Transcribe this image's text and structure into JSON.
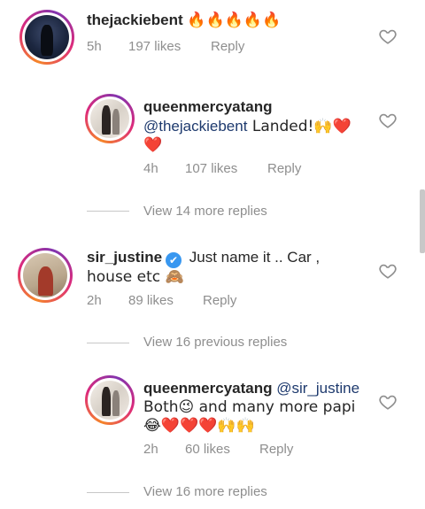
{
  "comments": [
    {
      "username": "thejackiebent",
      "text": "🔥🔥🔥🔥🔥",
      "time": "5h",
      "likes": "197 likes",
      "reply": "Reply"
    },
    {
      "username": "queenmercyatang",
      "mention": "@thejackiebent",
      "text": " Landed!🙌❤️",
      "text_line2": "❤️",
      "time": "4h",
      "likes": "107 likes",
      "reply": "Reply",
      "view_more": "View 14 more replies"
    },
    {
      "username": "sir_justine",
      "verified_icon": "✔",
      "text": " Just name it .. Car ,",
      "text_line2": "house etc 🙈",
      "time": "2h",
      "likes": "89 likes",
      "reply": "Reply",
      "view_previous": "View 16 previous replies"
    },
    {
      "username": "queenmercyatang",
      "mention": "@sir_justine",
      "text_line2": "Both😉 and many more papi",
      "text_line3": "😂❤️❤️❤️🙌🙌",
      "time": "2h",
      "likes": "60 likes",
      "reply": "Reply",
      "view_more": "View 16 more replies"
    }
  ],
  "colors": {
    "mention": "#1e3a6e",
    "meta": "#8e8e8e",
    "verified": "#3897f0"
  }
}
